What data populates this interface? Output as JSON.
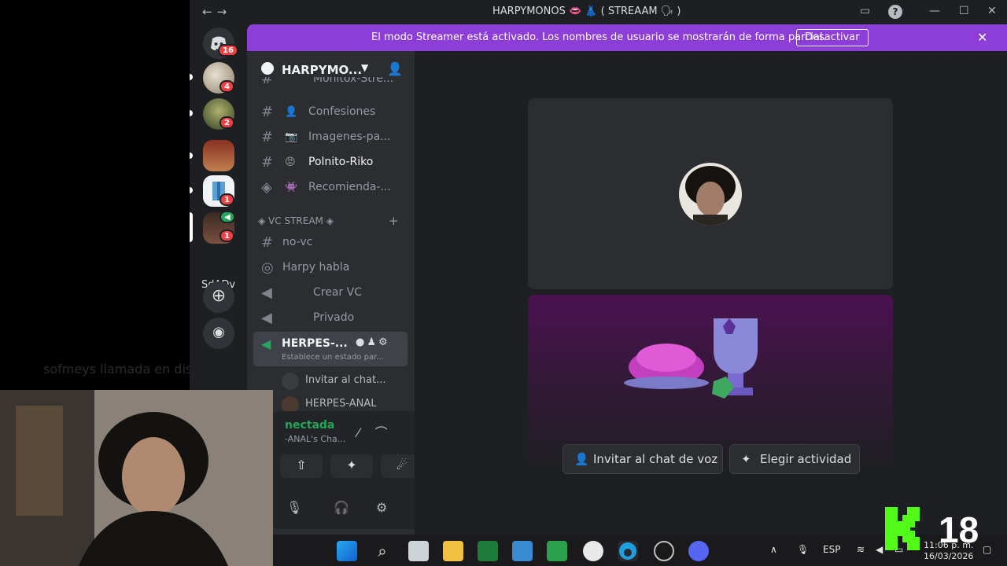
{
  "overlay": {
    "ghost_text": "sofmeys  llamada en discord"
  },
  "window": {
    "title": "HARPYMONOS 👄 👗 ( STREAAM 🗣 )"
  },
  "banner": {
    "message": "El modo Streamer está activado. Los nombres de usuario se mostrarán de forma parcial.",
    "button": "Desactivar"
  },
  "rail": {
    "badges": [
      "16",
      "4",
      "2",
      "1",
      "1"
    ],
    "text_server": "SdADv"
  },
  "server": {
    "name": "HARPYMO..."
  },
  "channels": [
    {
      "label": "Confesiones",
      "emoji": "👤"
    },
    {
      "label": "Imagenes-pa...",
      "emoji": "📷"
    },
    {
      "label": "Polnito-Riko",
      "emoji": "😡"
    },
    {
      "label": "Recomienda-...",
      "emoji": "👾"
    }
  ],
  "category": "◈ VC STREAM ◈",
  "voice_channels": [
    {
      "label": "no-vc"
    },
    {
      "label": "Harpy habla"
    },
    {
      "label": "Crear VC"
    },
    {
      "label": "Privado"
    }
  ],
  "active_voice": {
    "label": "HERPES-...",
    "status": "Establece un estado par..."
  },
  "voice_sub": [
    {
      "label": "Invitar al chat..."
    },
    {
      "label": "HERPES-ANAL"
    }
  ],
  "voice_panel": {
    "connected": "nectada",
    "channel": "-ANAL's Cha..."
  },
  "main": {
    "invite_button": "Invitar al chat de voz",
    "activity_button": "Elegir actividad"
  },
  "taskbar": {
    "lang": "ESP",
    "time": "11:06 p. m.",
    "date": "16/03/2026"
  },
  "watermark": {
    "number": "18"
  },
  "colors": {
    "accent": "#8d3ed8",
    "online": "#23a55a",
    "badge": "#f23f43"
  }
}
